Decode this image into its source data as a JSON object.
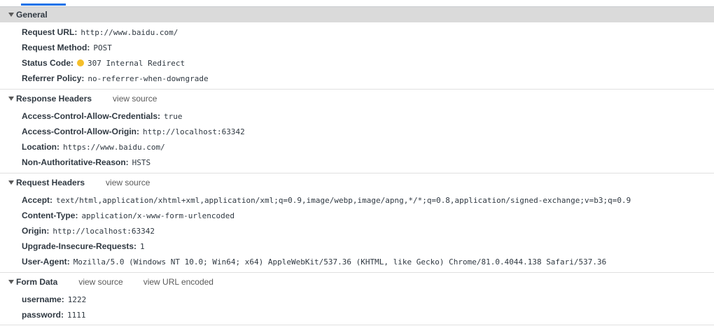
{
  "sections": {
    "general": {
      "title": "General",
      "rows": [
        {
          "key": "Request URL",
          "value": "http://www.baidu.com/"
        },
        {
          "key": "Request Method",
          "value": "POST"
        },
        {
          "key": "Status Code",
          "value": "307 Internal Redirect"
        },
        {
          "key": "Referrer Policy",
          "value": "no-referrer-when-downgrade"
        }
      ]
    },
    "response_headers": {
      "title": "Response Headers",
      "view_source": "view source",
      "rows": [
        {
          "key": "Access-Control-Allow-Credentials",
          "value": "true"
        },
        {
          "key": "Access-Control-Allow-Origin",
          "value": "http://localhost:63342"
        },
        {
          "key": "Location",
          "value": "https://www.baidu.com/"
        },
        {
          "key": "Non-Authoritative-Reason",
          "value": "HSTS"
        }
      ]
    },
    "request_headers": {
      "title": "Request Headers",
      "view_source": "view source",
      "rows": [
        {
          "key": "Accept",
          "value": "text/html,application/xhtml+xml,application/xml;q=0.9,image/webp,image/apng,*/*;q=0.8,application/signed-exchange;v=b3;q=0.9"
        },
        {
          "key": "Content-Type",
          "value": "application/x-www-form-urlencoded"
        },
        {
          "key": "Origin",
          "value": "http://localhost:63342"
        },
        {
          "key": "Upgrade-Insecure-Requests",
          "value": "1"
        },
        {
          "key": "User-Agent",
          "value": "Mozilla/5.0 (Windows NT 10.0; Win64; x64) AppleWebKit/537.36 (KHTML, like Gecko) Chrome/81.0.4044.138 Safari/537.36"
        }
      ]
    },
    "form_data": {
      "title": "Form Data",
      "view_source": "view source",
      "view_url_encoded": "view URL encoded",
      "rows": [
        {
          "key": "username",
          "value": "1222"
        },
        {
          "key": "password",
          "value": "1111"
        }
      ]
    }
  },
  "icons": {
    "collapse": "triangle-down-icon",
    "status": "status-dot-icon"
  },
  "colors": {
    "status_dot": "#f5bf2a",
    "active_tab": "#1a73e8",
    "general_header_bg": "#dadada"
  }
}
